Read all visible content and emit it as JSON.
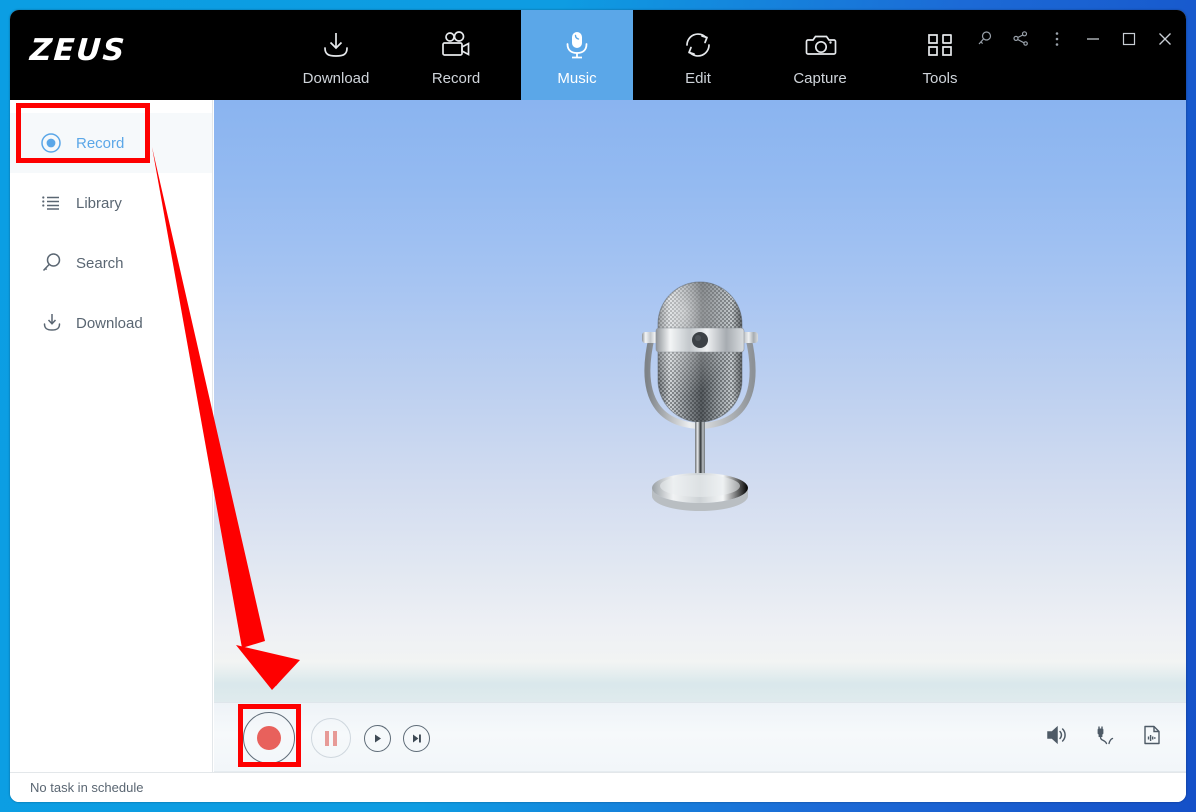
{
  "app": {
    "logo": "ZEUS",
    "accent_blue": "#5BA7E8",
    "border_blue": "#0b9ee3",
    "annotation_red": "#fe0000",
    "record_red": "#e8615c"
  },
  "topnav": {
    "tabs": [
      {
        "label": "Download",
        "icon": "download-tray-icon",
        "active": false
      },
      {
        "label": "Record",
        "icon": "video-camera-icon",
        "active": false
      },
      {
        "label": "Music",
        "icon": "microphone-icon",
        "active": true
      },
      {
        "label": "Edit",
        "icon": "refresh-cycle-icon",
        "active": false
      },
      {
        "label": "Capture",
        "icon": "camera-icon",
        "active": false
      },
      {
        "label": "Tools",
        "icon": "grid-squares-icon",
        "active": false
      }
    ],
    "window_controls": [
      {
        "name": "key-icon",
        "title": "Register"
      },
      {
        "name": "share-icon",
        "title": "Share"
      },
      {
        "name": "more-menu-icon",
        "title": "Menu"
      },
      {
        "name": "minimize-icon",
        "title": "Minimize"
      },
      {
        "name": "maximize-icon",
        "title": "Maximize"
      },
      {
        "name": "close-icon",
        "title": "Close"
      }
    ]
  },
  "sidebar": {
    "items": [
      {
        "label": "Record",
        "icon": "record-circle-icon",
        "active": true
      },
      {
        "label": "Library",
        "icon": "list-icon",
        "active": false
      },
      {
        "label": "Search",
        "icon": "magnifier-icon",
        "active": false
      },
      {
        "label": "Download",
        "icon": "download-tray-icon",
        "active": false
      }
    ]
  },
  "stage": {
    "artwork": "retro-microphone-illustration"
  },
  "transport": {
    "buttons": [
      {
        "name": "record-button",
        "label": "Record",
        "state": "enabled"
      },
      {
        "name": "pause-button",
        "label": "Pause",
        "state": "disabled"
      },
      {
        "name": "play-button",
        "label": "Play",
        "state": "enabled"
      },
      {
        "name": "next-track-button",
        "label": "Next",
        "state": "enabled"
      }
    ],
    "right_controls": [
      {
        "name": "speaker-volume-icon",
        "label": "Volume"
      },
      {
        "name": "microphone-jack-icon",
        "label": "Audio input"
      },
      {
        "name": "audio-file-icon",
        "label": "Output file"
      }
    ]
  },
  "statusbar": {
    "text": "No task in schedule"
  },
  "annotations": [
    {
      "name": "sidebar-record-highlight",
      "shape": "rect"
    },
    {
      "name": "record-button-highlight",
      "shape": "rect"
    },
    {
      "name": "pointer-arrow",
      "shape": "arrow"
    }
  ]
}
